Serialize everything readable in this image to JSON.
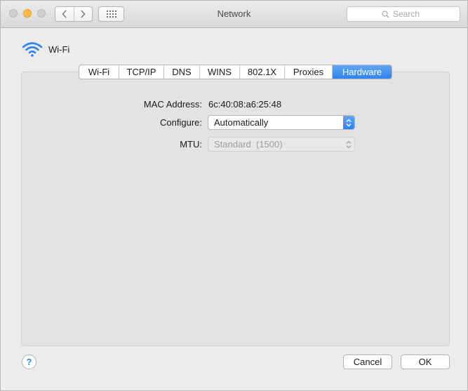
{
  "window": {
    "title": "Network",
    "search_placeholder": "Search"
  },
  "interface": {
    "name": "Wi-Fi",
    "icon": "wifi-icon"
  },
  "tabs": [
    {
      "label": "Wi-Fi",
      "active": false
    },
    {
      "label": "TCP/IP",
      "active": false
    },
    {
      "label": "DNS",
      "active": false
    },
    {
      "label": "WINS",
      "active": false
    },
    {
      "label": "802.1X",
      "active": false
    },
    {
      "label": "Proxies",
      "active": false
    },
    {
      "label": "Hardware",
      "active": true
    }
  ],
  "hardware": {
    "mac_label": "MAC Address:",
    "mac_value": "6c:40:08:a6:25:48",
    "configure_label": "Configure:",
    "configure_value": "Automatically",
    "mtu_label": "MTU:",
    "mtu_value": "Standard  (1500)"
  },
  "footer": {
    "help_label": "?",
    "cancel_label": "Cancel",
    "ok_label": "OK"
  },
  "colors": {
    "accent": "#2f82ef",
    "minimize": "#fdbc40"
  }
}
